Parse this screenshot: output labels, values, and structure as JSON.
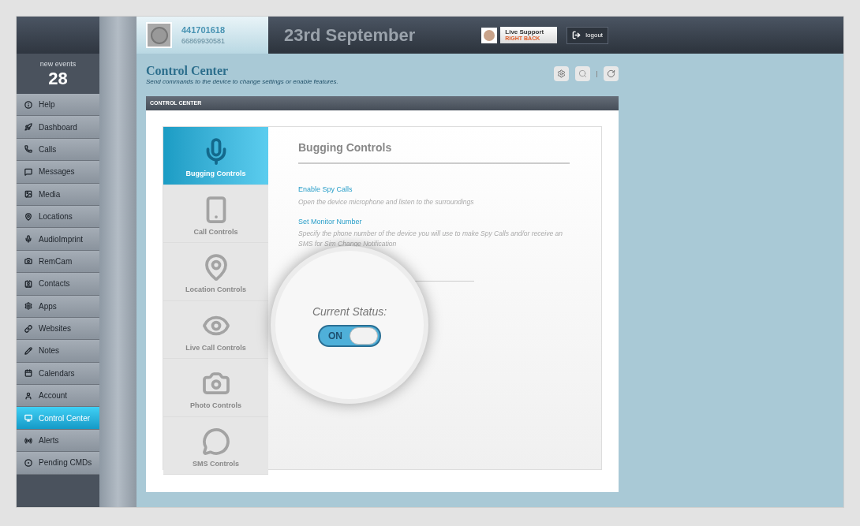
{
  "user": {
    "id": "441701618",
    "phone": "66869930581"
  },
  "date": "23rd September",
  "support": {
    "title": "Live Support",
    "status": "RIGHT BACK"
  },
  "logout": "logout",
  "events": {
    "label": "new events",
    "count": "28"
  },
  "sidebar": {
    "items": [
      {
        "label": "Help",
        "selected": false
      },
      {
        "label": "Dashboard",
        "selected": false
      },
      {
        "label": "Calls",
        "selected": false
      },
      {
        "label": "Messages",
        "selected": false
      },
      {
        "label": "Media",
        "selected": false
      },
      {
        "label": "Locations",
        "selected": false
      },
      {
        "label": "AudioImprint",
        "selected": false
      },
      {
        "label": "RemCam",
        "selected": false
      },
      {
        "label": "Contacts",
        "selected": false
      },
      {
        "label": "Apps",
        "selected": false
      },
      {
        "label": "Websites",
        "selected": false
      },
      {
        "label": "Notes",
        "selected": false
      },
      {
        "label": "Calendars",
        "selected": false
      },
      {
        "label": "Account",
        "selected": false
      },
      {
        "label": "Control Center",
        "selected": true
      },
      {
        "label": "Alerts",
        "selected": false
      },
      {
        "label": "Pending CMDs",
        "selected": false
      }
    ]
  },
  "page": {
    "title": "Control Center",
    "subtitle": "Send commands to the device to change settings or enable features."
  },
  "panel": {
    "header": "CONTROL CENTER",
    "tabs": [
      {
        "label": "Bugging Controls",
        "selected": true
      },
      {
        "label": "Call Controls",
        "selected": false
      },
      {
        "label": "Location Controls",
        "selected": false
      },
      {
        "label": "Live Call Controls",
        "selected": false
      },
      {
        "label": "Photo Controls",
        "selected": false
      },
      {
        "label": "SMS Controls",
        "selected": false
      }
    ],
    "heading": "Bugging Controls",
    "features": [
      {
        "title": "Enable Spy Calls",
        "description": "Open the device microphone and listen to the surroundings"
      },
      {
        "title": "Set Monitor Number",
        "description": "Specify the phone number of the device you will use to make Spy Calls and/or receive an SMS for Sim Change Notification"
      }
    ],
    "status": {
      "label": "Current Status:",
      "toggle_text": "ON",
      "on": true
    }
  }
}
